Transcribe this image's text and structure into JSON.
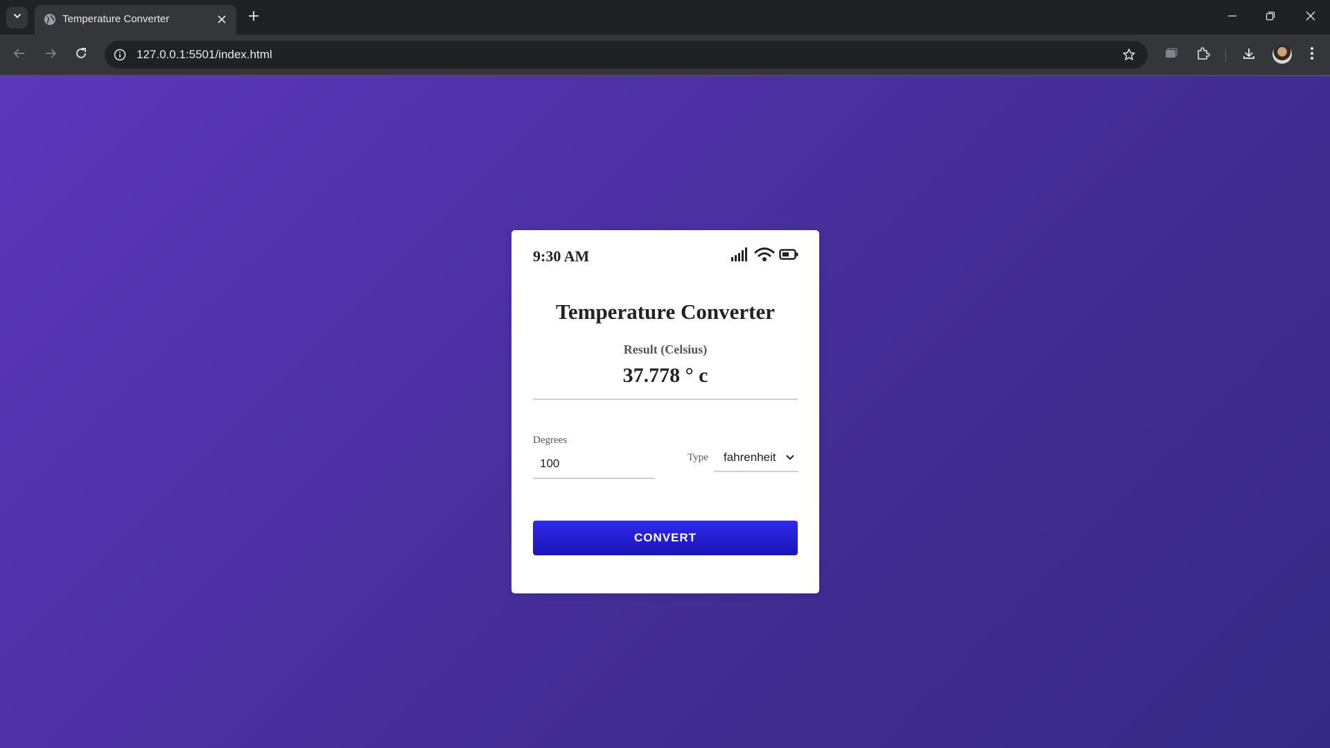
{
  "browser": {
    "tab_title": "Temperature Converter",
    "url": "127.0.0.1:5501/index.html"
  },
  "status_bar": {
    "time": "9:30 AM",
    "icons": [
      "signal-icon",
      "wifi-icon",
      "battery-icon"
    ]
  },
  "app": {
    "title": "Temperature Converter",
    "result_label": "Result (Celsius)",
    "result_value": "37.778 ° c",
    "degrees_label": "Degrees",
    "degrees_value": "100",
    "type_label": "Type",
    "type_selected": "fahrenheit",
    "convert_label": "CONVERT"
  },
  "colors": {
    "background_gradient_start": "#5c37bb",
    "background_gradient_end": "#362985",
    "button": "#2420d6",
    "card": "#ffffff"
  }
}
